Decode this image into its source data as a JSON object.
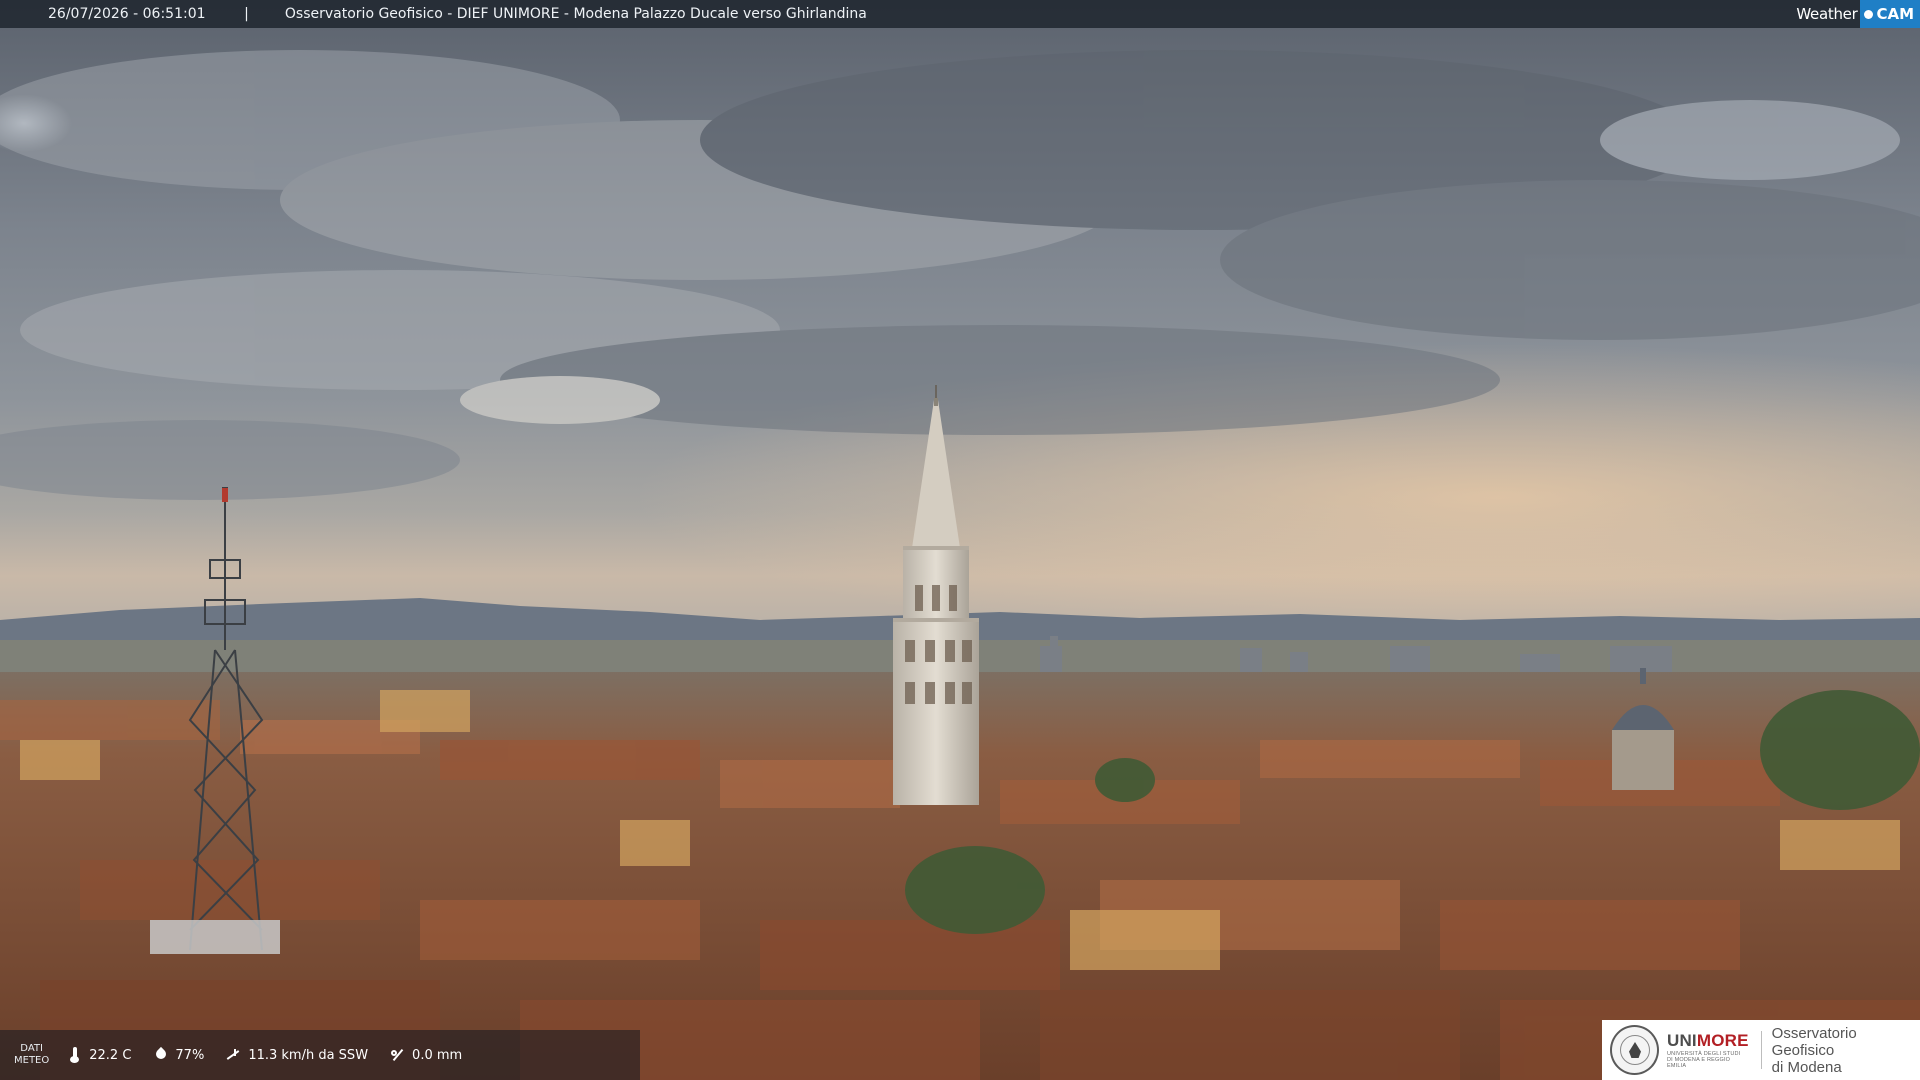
{
  "header": {
    "timestamp": "26/07/2026 - 06:51:01",
    "separator": "|",
    "caption": "Osservatorio Geofisico - DIEF UNIMORE - Modena Palazzo Ducale verso Ghirlandina"
  },
  "webcam_logo": {
    "part1": "Weather",
    "part2": "CAM"
  },
  "weather": {
    "label_line1": "DATI",
    "label_line2": "METEO",
    "temperature": "22.2 C",
    "humidity": "77%",
    "wind": "11.3 km/h da SSW",
    "rain": "0.0 mm"
  },
  "badge": {
    "uni_part1": "UNI",
    "uni_part2": "MORE",
    "uni_subtitle": "UNIVERSITÀ DEGLI STUDI DI MODENA E REGGIO EMILIA",
    "observatory_line1": "Osservatorio Geofisico",
    "observatory_line2": "di Modena"
  },
  "colors": {
    "sky_top": "#5f6670",
    "sky_mid": "#8d949c",
    "horizon_glow": "#e8c9a8",
    "mountains": "#6d7785",
    "roofs": "#9a5a3a",
    "tower_stone": "#d9d3c8",
    "logo_blue": "#1f7fc6",
    "accent_red": "#b21f24"
  }
}
